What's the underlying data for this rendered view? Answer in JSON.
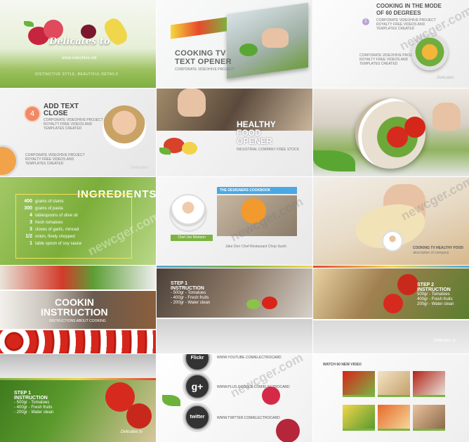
{
  "t1": {
    "title": "Delicates to",
    "site": "www.videohive.net",
    "tag": "DISTINCTIVE STYLE, BEAUTIFUL DETAILS"
  },
  "t2": {
    "title_a": "COOKING TV",
    "title_b": "TEXT OPENER",
    "sub": "CORPORATE VIDEOHIVE PROJECT"
  },
  "t3": {
    "num": "1",
    "title_a": "COOKING IN THE MODE",
    "title_b": "OF 60 DEGREES",
    "l1": "CORPORATE VIDEOHIVE PROJECT",
    "l2": "ROYALTY FREE VIDEOS AND",
    "l3": "TEMPLATES CREATED",
    "b1": "CORPORATE VIDEOHIVE PROJECT",
    "b2": "ROYALTY FREE VIDEOS AND",
    "b3": "TEMPLATES CREATED",
    "logo": "Delicates"
  },
  "t4": {
    "num": "4",
    "title_a": "ADD TEXT",
    "title_b": "CLOSE",
    "l1": "CORPORATE VIDEOHIVE PROJECT",
    "l2": "ROYALTY FREE VIDEOS AND",
    "l3": "TEMPLATES CREATED",
    "b1": "CORPORATE VIDEOHIVE PROJECT",
    "b2": "ROYALTY FREE VIDEOS AND",
    "b3": "TEMPLATES CREATED",
    "logo": "Delicates"
  },
  "t5": {
    "title_a": "HEALTHY",
    "title_b": "FOOD",
    "title_c": "OPENER",
    "sub": "INDUSTRIAL COMPANY FREE STOCK"
  },
  "t7": {
    "heading": "INGREDIENTS:",
    "rows": [
      {
        "q": "400",
        "txt": "grams of clams"
      },
      {
        "q": "300",
        "txt": "grams of pasta"
      },
      {
        "q": "4",
        "txt": "tablespoons of olive oil"
      },
      {
        "q": "3",
        "txt": "fresh tomatoes"
      },
      {
        "q": "3",
        "txt": "cloves of garlic, minced"
      },
      {
        "q": "1/2",
        "txt": "onion, finely chopped"
      },
      {
        "q": "1",
        "txt": "table spoon of soy sauce"
      }
    ]
  },
  "t8": {
    "banner": "THE DESIGNERS COOKBOOK",
    "chef": "Chef Jon Mortson",
    "caption": "Jake Dorr Chef Restaurant Chop Sushi"
  },
  "t9": {
    "label": "COOKING TV HEALTHY FOOD",
    "sub": "description of company"
  },
  "t10": {
    "title_a": "COOKIN",
    "title_b": "INSTRUCTION",
    "sub": "INSTRUCTIONS ABOUT COOKING"
  },
  "t11": {
    "title": "STEP 1",
    "title2": "INSTRUCTION",
    "l1": "- 500gr - Tomatoes",
    "l2": "- 400gr - Fresh fruits",
    "l3": "- 200gr - Water clean"
  },
  "t12": {
    "title": "STEP 2",
    "title2": "INSTRUCTION",
    "l1": "500gr - Tomatoes",
    "l2": "400gr - Fresh fruits",
    "l3": "200gr - Water clean",
    "logo": "Delicates tv"
  },
  "t13": {
    "title": "STEP 1",
    "title2": "INSTRUCTION",
    "l1": "- 500gr - Tomatoes",
    "l2": "- 400gr - Fresh fruits",
    "l3": "- 200gr - Water clean",
    "logo": "Delicates tv"
  },
  "t14": {
    "s1": "Flickr",
    "s2": "g+",
    "s3": "twitter",
    "u1": "WWW.YOUTUBE.COM/ELECTROCARD",
    "u2": "WWW.PLUS.GOOGLE.COM/ELECTROCARD",
    "u3": "WWW.TWITTER.COM/ELECTROCARD"
  },
  "t15": {
    "watch": "WATCH 60 NEW VIDEO"
  },
  "watermark": "newcger.com",
  "colors": {
    "green": "#7db33a",
    "orange": "#f08a3c",
    "red": "#d8241a",
    "blue": "#3aa3e0"
  }
}
